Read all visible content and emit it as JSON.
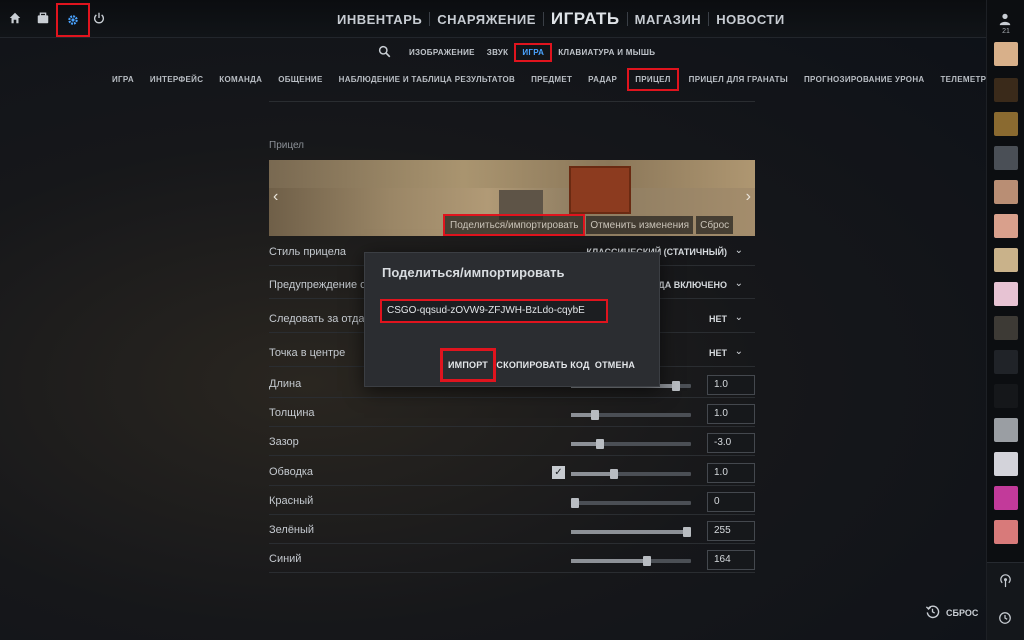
{
  "topbar": {
    "icons": [
      "home-icon",
      "inventory-bag-icon",
      "settings-gear-icon",
      "power-icon"
    ],
    "nav": [
      {
        "label": "ИНВЕНТАРЬ",
        "big": false
      },
      {
        "label": "СНАРЯЖЕНИЕ",
        "big": false
      },
      {
        "label": "ИГРАТЬ",
        "big": true
      },
      {
        "label": "МАГАЗИН",
        "big": false
      },
      {
        "label": "НОВОСТИ",
        "big": false
      }
    ]
  },
  "subnav": [
    "ИЗОБРАЖЕНИЕ",
    "ЗВУК",
    "ИГРА",
    "КЛАВИАТУРА И МЫШЬ"
  ],
  "subnav_active": "ИГРА",
  "tabs": [
    "ИГРА",
    "ИНТЕРФЕЙС",
    "КОМАНДА",
    "ОБЩЕНИЕ",
    "НАБЛЮДЕНИЕ И ТАБЛИЦА РЕЗУЛЬТАТОВ",
    "ПРЕДМЕТ",
    "РАДАР",
    "ПРИЦЕЛ",
    "ПРИЦЕЛ ДЛЯ ГРАНАТЫ",
    "ПРОГНОЗИРОВАНИЕ УРОНА",
    "ТЕЛЕМЕТРИЯ"
  ],
  "tab_active": "ПРИЦЕЛ",
  "section": {
    "title": "Прицел"
  },
  "preview": {
    "share_label": "Поделиться/импортировать",
    "undo_label": "Отменить изменения",
    "reset_label": "Сброс"
  },
  "settings": [
    {
      "label": "Стиль прицела",
      "value": "КЛАССИЧЕСКИЙ (СТАТИЧНЫЙ)",
      "type": "dropdown"
    },
    {
      "label": "Предупреждение о...",
      "value": "КОГДА ВКЛЮЧЕНО",
      "type": "dropdown"
    },
    {
      "label": "Следовать за отдачей",
      "value": "НЕТ",
      "type": "dropdown"
    },
    {
      "label": "Точка в центре",
      "value": "НЕТ",
      "type": "dropdown"
    },
    {
      "label": "Длина",
      "value": "1.0",
      "type": "slider",
      "level": 0.9
    },
    {
      "label": "Толщина",
      "value": "1.0",
      "type": "slider",
      "level": 0.18
    },
    {
      "label": "Зазор",
      "value": "-3.0",
      "type": "slider",
      "level": 0.22
    },
    {
      "label": "Обводка",
      "value": "1.0",
      "type": "slider-check",
      "level": 0.35
    },
    {
      "label": "Красный",
      "value": "0",
      "type": "slider",
      "level": 0.0
    },
    {
      "label": "Зелёный",
      "value": "255",
      "type": "slider",
      "level": 1.0
    },
    {
      "label": "Синий",
      "value": "164",
      "type": "slider",
      "level": 0.64
    }
  ],
  "modal": {
    "title": "Поделиться/импортировать",
    "code": "CSGO-qqsud-zOVW9-ZFJWH-BzLdo-cqybE",
    "import_label": "ИМПОРТ",
    "copy_label": "СКОПИРОВАТЬ КОД",
    "cancel_label": "ОТМЕНА"
  },
  "friends": {
    "count": "21"
  },
  "footer": {
    "reset_label": "СБРОС"
  },
  "colors": {
    "accent": "#4aa3ff",
    "highlight": "#e0141e"
  }
}
